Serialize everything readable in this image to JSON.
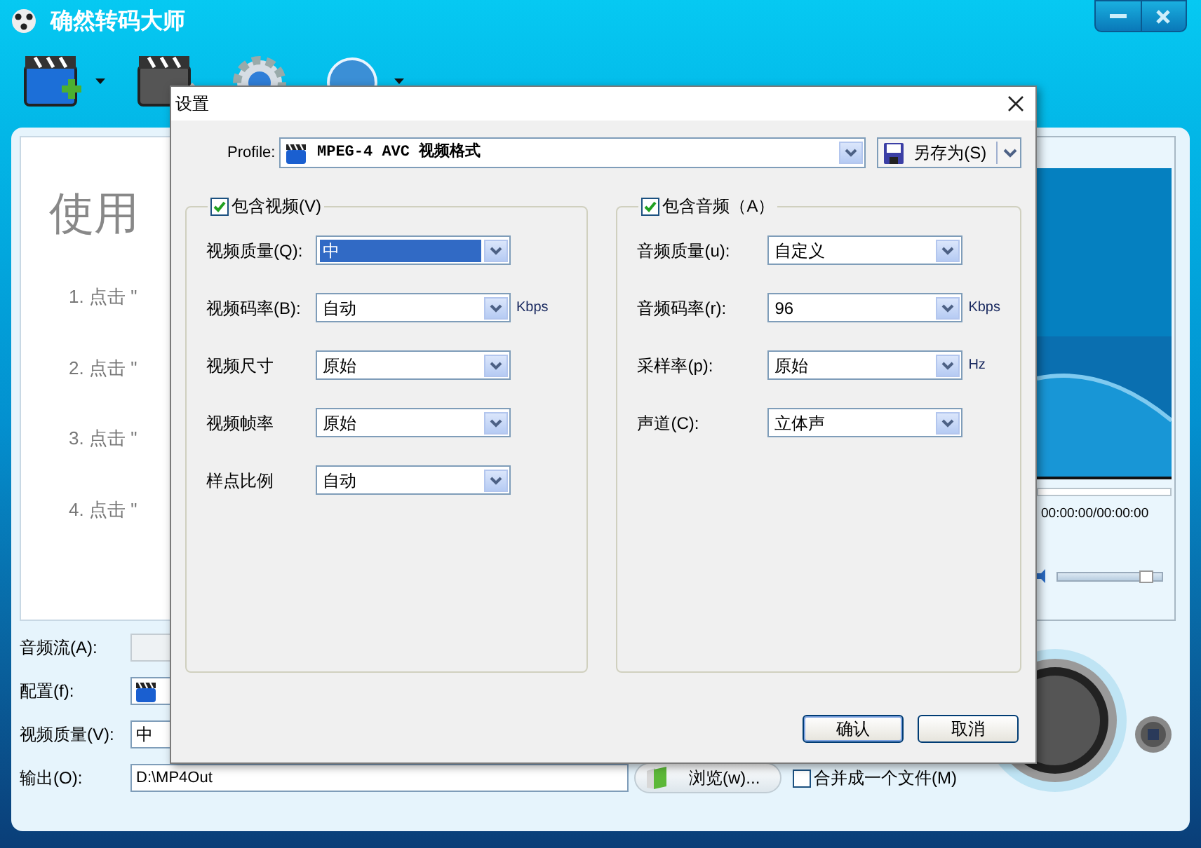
{
  "app": {
    "title": "确然转码大师"
  },
  "guide": {
    "heading": "使用",
    "steps": [
      "1. 点击 \"",
      "2. 点击 \"",
      "3. 点击 \"",
      "4. 点击 \""
    ]
  },
  "preview": {
    "time": "00:00:00/00:00:00",
    "volume": {
      "level": 0.92
    }
  },
  "bottom": {
    "audio_stream": {
      "label": "音频流(A):",
      "disabled": true
    },
    "profile": {
      "label": "配置(f):"
    },
    "quality": {
      "label": "视频质量(V):",
      "value": "中"
    },
    "output": {
      "label": "输出(O):",
      "value": "D:\\MP4Out"
    },
    "browse_button": "浏览(w)...",
    "merge": {
      "label": "合并成一个文件(M)",
      "checked": false
    }
  },
  "dialog": {
    "title": "设置",
    "profile": {
      "label": "Profile:",
      "value": "MPEG-4 AVC 视频格式"
    },
    "save_as": "另存为(S)",
    "video": {
      "label": "包含视频(V)",
      "checked": true,
      "rows": [
        {
          "label": "视频质量(Q):",
          "value": "中",
          "selected": true
        },
        {
          "label": "视频码率(B):",
          "value": "自动",
          "unit": "Kbps",
          "selected": false
        },
        {
          "label": "视频尺寸",
          "value": "原始",
          "selected": false
        },
        {
          "label": "视频帧率",
          "value": "原始",
          "selected": false
        },
        {
          "label": "样点比例",
          "value": "自动",
          "selected": false
        }
      ]
    },
    "audio": {
      "label": "包含音频（A）",
      "checked": true,
      "rows": [
        {
          "label": "音频质量(u):",
          "value": "自定义",
          "selected": false
        },
        {
          "label": "音频码率(r):",
          "value": "96",
          "unit": "Kbps",
          "selected": false
        },
        {
          "label": "采样率(p):",
          "value": "原始",
          "unit": "Hz",
          "selected": false
        },
        {
          "label": "声道(C):",
          "value": "立体声",
          "selected": false
        }
      ]
    },
    "buttons": [
      {
        "label": "确认",
        "default": true
      },
      {
        "label": "取消",
        "default": false
      }
    ]
  }
}
